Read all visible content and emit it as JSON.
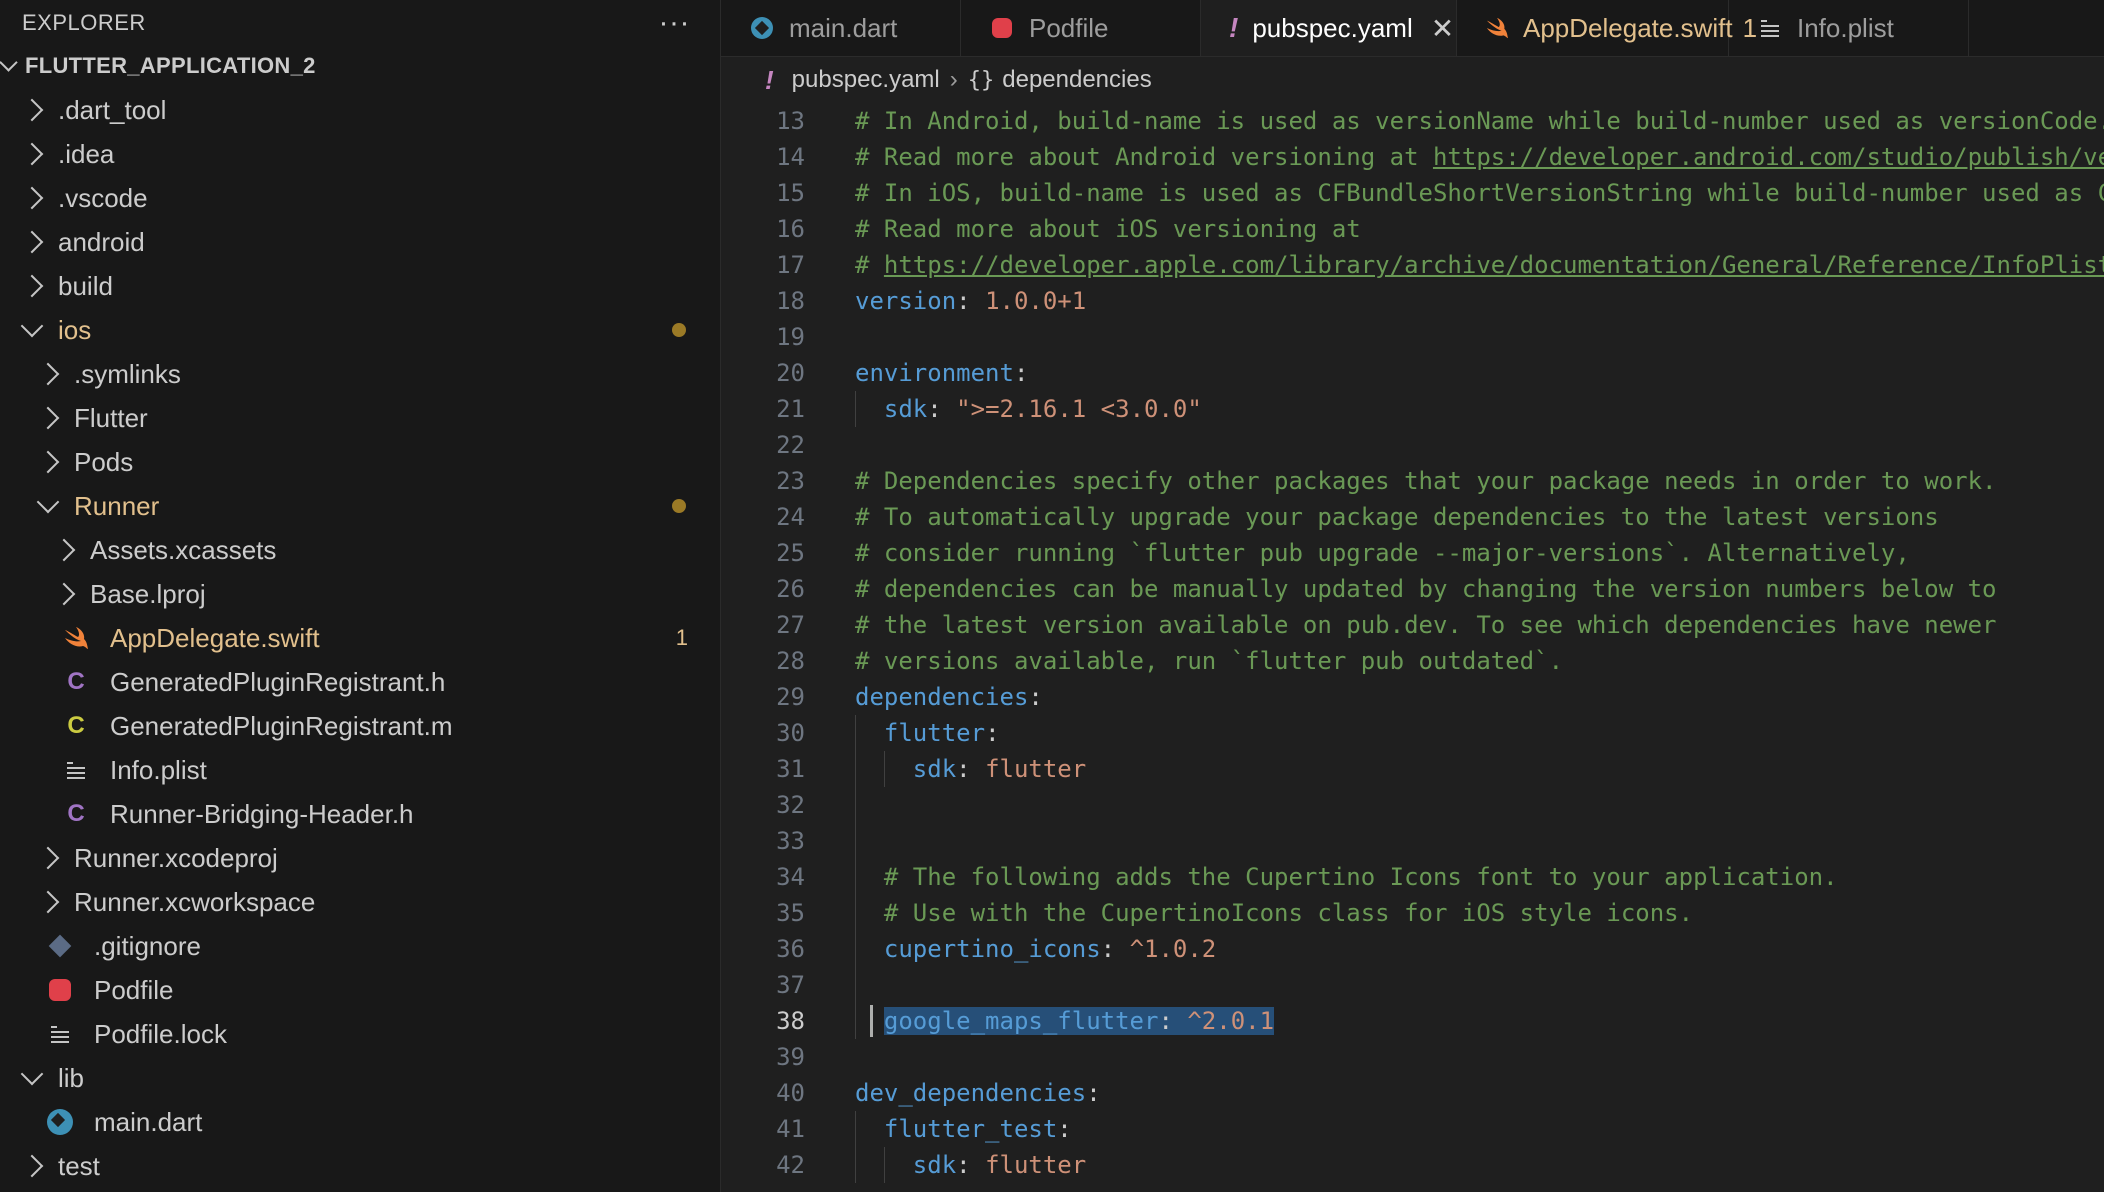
{
  "explorer": {
    "title": "EXPLORER",
    "more": "···",
    "project": "FLUTTER_APPLICATION_2",
    "items": [
      {
        "label": ".dart_tool",
        "depth": 0,
        "kind": "folder"
      },
      {
        "label": ".idea",
        "depth": 0,
        "kind": "folder"
      },
      {
        "label": ".vscode",
        "depth": 0,
        "kind": "folder"
      },
      {
        "label": "android",
        "depth": 0,
        "kind": "folder"
      },
      {
        "label": "build",
        "depth": 0,
        "kind": "folder"
      },
      {
        "label": "ios",
        "depth": 0,
        "kind": "folder-open",
        "modified": true
      },
      {
        "label": ".symlinks",
        "depth": 1,
        "kind": "folder"
      },
      {
        "label": "Flutter",
        "depth": 1,
        "kind": "folder"
      },
      {
        "label": "Pods",
        "depth": 1,
        "kind": "folder"
      },
      {
        "label": "Runner",
        "depth": 1,
        "kind": "folder-open",
        "modified": true
      },
      {
        "label": "Assets.xcassets",
        "depth": 2,
        "kind": "folder"
      },
      {
        "label": "Base.lproj",
        "depth": 2,
        "kind": "folder"
      },
      {
        "label": "AppDelegate.swift",
        "depth": 2,
        "kind": "swift",
        "badge": "1"
      },
      {
        "label": "GeneratedPluginRegistrant.h",
        "depth": 2,
        "kind": "c-purple"
      },
      {
        "label": "GeneratedPluginRegistrant.m",
        "depth": 2,
        "kind": "c-yellow"
      },
      {
        "label": "Info.plist",
        "depth": 2,
        "kind": "lines"
      },
      {
        "label": "Runner-Bridging-Header.h",
        "depth": 2,
        "kind": "c-purple"
      },
      {
        "label": "Runner.xcodeproj",
        "depth": 1,
        "kind": "folder"
      },
      {
        "label": "Runner.xcworkspace",
        "depth": 1,
        "kind": "folder"
      },
      {
        "label": ".gitignore",
        "depth": 1,
        "kind": "git"
      },
      {
        "label": "Podfile",
        "depth": 1,
        "kind": "ruby"
      },
      {
        "label": "Podfile.lock",
        "depth": 1,
        "kind": "lines"
      },
      {
        "label": "lib",
        "depth": 0,
        "kind": "folder-open"
      },
      {
        "label": "main.dart",
        "depth": 1,
        "kind": "dart"
      },
      {
        "label": "test",
        "depth": 0,
        "kind": "folder"
      }
    ]
  },
  "tabs": [
    {
      "label": "main.dart",
      "icon": "dart-icon"
    },
    {
      "label": "Podfile",
      "icon": "ruby-icon"
    },
    {
      "label": "pubspec.yaml",
      "icon": "yaml-icon",
      "active": true
    },
    {
      "label": "AppDelegate.swift",
      "icon": "swift-icon",
      "count": "1"
    },
    {
      "label": "Info.plist",
      "icon": "list-icon"
    }
  ],
  "breadcrumb": {
    "file": "pubspec.yaml",
    "symbol": "dependencies",
    "braces": "{}"
  },
  "editor": {
    "current_line": 38,
    "lines": [
      {
        "n": 13,
        "indent": 0,
        "parts": [
          [
            "c",
            "# In Android, build-name is used as versionName while build-number used as versionCode."
          ]
        ]
      },
      {
        "n": 14,
        "indent": 0,
        "parts": [
          [
            "c",
            "# Read more about Android versioning at "
          ],
          [
            "u",
            "https://developer.android.com/studio/publish/ve"
          ]
        ]
      },
      {
        "n": 15,
        "indent": 0,
        "parts": [
          [
            "c",
            "# In iOS, build-name is used as CFBundleShortVersionString while build-number used as C"
          ]
        ]
      },
      {
        "n": 16,
        "indent": 0,
        "parts": [
          [
            "c",
            "# Read more about iOS versioning at"
          ]
        ]
      },
      {
        "n": 17,
        "indent": 0,
        "parts": [
          [
            "c",
            "# "
          ],
          [
            "u",
            "https://developer.apple.com/library/archive/documentation/General/Reference/InfoPlist"
          ]
        ]
      },
      {
        "n": 18,
        "indent": 0,
        "parts": [
          [
            "k",
            "version"
          ],
          [
            "p",
            ": "
          ],
          [
            "v",
            "1.0.0+1"
          ]
        ]
      },
      {
        "n": 19,
        "indent": 0,
        "parts": []
      },
      {
        "n": 20,
        "indent": 0,
        "parts": [
          [
            "k",
            "environment"
          ],
          [
            "p",
            ":"
          ]
        ]
      },
      {
        "n": 21,
        "indent": 1,
        "parts": [
          [
            "k",
            "sdk"
          ],
          [
            "p",
            ": "
          ],
          [
            "v",
            "\">=2.16.1 <3.0.0\""
          ]
        ]
      },
      {
        "n": 22,
        "indent": 0,
        "parts": []
      },
      {
        "n": 23,
        "indent": 0,
        "parts": [
          [
            "c",
            "# Dependencies specify other packages that your package needs in order to work."
          ]
        ]
      },
      {
        "n": 24,
        "indent": 0,
        "parts": [
          [
            "c",
            "# To automatically upgrade your package dependencies to the latest versions"
          ]
        ]
      },
      {
        "n": 25,
        "indent": 0,
        "parts": [
          [
            "c",
            "# consider running `flutter pub upgrade --major-versions`. Alternatively,"
          ]
        ]
      },
      {
        "n": 26,
        "indent": 0,
        "parts": [
          [
            "c",
            "# dependencies can be manually updated by changing the version numbers below to"
          ]
        ]
      },
      {
        "n": 27,
        "indent": 0,
        "parts": [
          [
            "c",
            "# the latest version available on pub.dev. To see which dependencies have newer"
          ]
        ]
      },
      {
        "n": 28,
        "indent": 0,
        "parts": [
          [
            "c",
            "# versions available, run `flutter pub outdated`."
          ]
        ]
      },
      {
        "n": 29,
        "indent": 0,
        "parts": [
          [
            "k",
            "dependencies"
          ],
          [
            "p",
            ":"
          ]
        ]
      },
      {
        "n": 30,
        "indent": 1,
        "parts": [
          [
            "k",
            "flutter"
          ],
          [
            "p",
            ":"
          ]
        ]
      },
      {
        "n": 31,
        "indent": 2,
        "parts": [
          [
            "k",
            "sdk"
          ],
          [
            "p",
            ": "
          ],
          [
            "v",
            "flutter"
          ]
        ]
      },
      {
        "n": 32,
        "indent": 0,
        "parts": []
      },
      {
        "n": 33,
        "indent": 0,
        "parts": []
      },
      {
        "n": 34,
        "indent": 1,
        "parts": [
          [
            "c",
            "# The following adds the Cupertino Icons font to your application."
          ]
        ]
      },
      {
        "n": 35,
        "indent": 1,
        "parts": [
          [
            "c",
            "# Use with the CupertinoIcons class for iOS style icons."
          ]
        ]
      },
      {
        "n": 36,
        "indent": 1,
        "parts": [
          [
            "k",
            "cupertino_icons"
          ],
          [
            "p",
            ": "
          ],
          [
            "v",
            "^1.0.2"
          ]
        ]
      },
      {
        "n": 37,
        "indent": 0,
        "parts": []
      },
      {
        "n": 38,
        "indent": 1,
        "selected": true,
        "parts": [
          [
            "k",
            "google_maps_flutter"
          ],
          [
            "p",
            ": "
          ],
          [
            "v",
            "^2.0.1"
          ]
        ]
      },
      {
        "n": 39,
        "indent": 0,
        "parts": []
      },
      {
        "n": 40,
        "indent": 0,
        "parts": [
          [
            "k",
            "dev_dependencies"
          ],
          [
            "p",
            ":"
          ]
        ]
      },
      {
        "n": 41,
        "indent": 1,
        "parts": [
          [
            "k",
            "flutter_test"
          ],
          [
            "p",
            ":"
          ]
        ]
      },
      {
        "n": 42,
        "indent": 2,
        "parts": [
          [
            "k",
            "sdk"
          ],
          [
            "p",
            ": "
          ],
          [
            "v",
            "flutter"
          ]
        ]
      }
    ]
  },
  "colors": {
    "comment": "#6a9955",
    "key": "#569cd6",
    "value": "#ce9178",
    "modified": "#e2c08d",
    "selection": "#264f78"
  }
}
